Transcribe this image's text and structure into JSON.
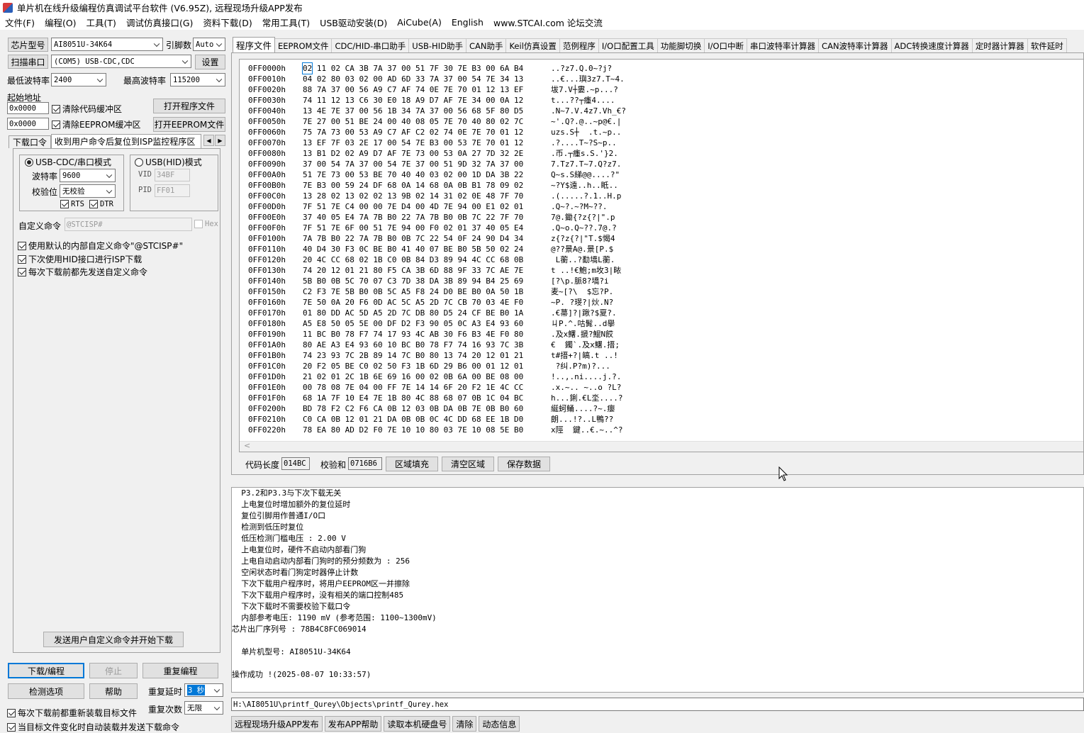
{
  "window": {
    "title": "单片机在线升级编程仿真调试平台软件 (V6.95Z), 远程现场升级APP发布"
  },
  "menu": [
    "文件(F)",
    "编程(O)",
    "工具(T)",
    "调试仿真接口(G)",
    "资料下载(D)",
    "常用工具(T)",
    "USB驱动安装(D)",
    "AiCube(A)",
    "English",
    "www.STCAI.com 论坛交流"
  ],
  "left": {
    "chip_btn": "芯片型号",
    "chip_value": "AI8051U-34K64",
    "pin_label": "引脚数",
    "pin_value": "Auto",
    "scan_btn": "扫描串口",
    "port_value": "(COM5) USB-CDC,CDC",
    "settings_btn": "设置",
    "min_baud_label": "最低波特率",
    "min_baud_value": "2400",
    "max_baud_label": "最高波特率",
    "max_baud_value": "115200",
    "start_addr_label": "起始地址",
    "addr1": "0x0000",
    "clear_code_label": "清除代码缓冲区",
    "open_prog_btn": "打开程序文件",
    "addr2": "0x0000",
    "clear_eeprom_label": "清除EEPROM缓冲区",
    "open_eeprom_btn": "打开EEPROM文件",
    "subtab1": "下载口令",
    "subtab2": "收到用户命令后复位到ISP监控程序区",
    "usb_cdc_mode": "USB-CDC/串口模式",
    "usb_hid_mode": "USB(HID)模式",
    "baud_label": "波特率",
    "baud_value": "9600",
    "parity_label": "校验位",
    "parity_value": "无校验",
    "rts_label": "RTS",
    "dtr_label": "DTR",
    "vid_label": "VID",
    "vid_value": "34BF",
    "pid_label": "PID",
    "pid_value": "FF01",
    "custom_cmd_label": "自定义命令",
    "custom_cmd_value": "@STCISP#",
    "hex_label": "Hex",
    "opt1": "使用默认的内部自定义命令\"@STCISP#\"",
    "opt2": "下次使用HID接口进行ISP下载",
    "opt3": "每次下载前都先发送自定义命令",
    "send_btn": "发送用户自定义命令并开始下载",
    "download_btn": "下载/编程",
    "stop_btn": "停止",
    "reprogram_btn": "重复编程",
    "check_btn": "检测选项",
    "help_btn": "帮助",
    "repeat_delay_label": "重复延时",
    "repeat_delay_value": "3 秒",
    "reload_label": "每次下载前都重新装载目标文件",
    "repeat_count_label": "重复次数",
    "repeat_count_value": "无限",
    "auto_label": "当目标文件变化时自动装载并发送下载命令"
  },
  "tabs": [
    "程序文件",
    "EEPROM文件",
    "CDC/HID-串口助手",
    "USB-HID助手",
    "CAN助手",
    "Keil仿真设置",
    "范例程序",
    "I/O口配置工具",
    "功能脚切换",
    "I/O口中断",
    "串口波特率计算器",
    "CAN波特率计算器",
    "ADC转换速度计算器",
    "定时器计算器",
    "软件延时"
  ],
  "hex": [
    {
      "a": "0FF0000h",
      "h": "02 11 02 CA 3B 7A 37 00 51 7F 30 7E B3 00 6A B4",
      "t": "..?z7.Q.0~?j?"
    },
    {
      "a": "0FF0010h",
      "h": "04 02 80 03 02 00 AD 6D 33 7A 37 00 54 7E 34 13",
      "t": "..€...璵3z7.T~4."
    },
    {
      "a": "0FF0020h",
      "h": "88 7A 37 00 56 A9 C7 AF 74 0E 7E 70 01 12 13 EF",
      "t": "坺7.V┼婁.~p...?"
    },
    {
      "a": "0FF0030h",
      "h": "74 11 12 13 C6 30 E0 18 A9 D7 AF 7E 34 00 0A 12",
      "t": "t...??┬瘇4...."
    },
    {
      "a": "0FF0040h",
      "h": "13 4E 7E 37 00 56 1B 34 7A 37 00 56 68 5F 80 D5",
      "t": ".N~7.V.4z7.Vh_€?"
    },
    {
      "a": "0FF0050h",
      "h": "7E 27 00 51 BE 24 00 40 08 05 7E 70 40 80 02 7C",
      "t": "~'.Q?.@..~p@€.|"
    },
    {
      "a": "0FF0060h",
      "h": "75 7A 73 00 53 A9 C7 AF C2 02 74 0E 7E 70 01 12",
      "t": "uzs.S┼  .t.~p.."
    },
    {
      "a": "0FF0070h",
      "h": "13 EF 7F 03 2E 17 00 54 7E B3 00 53 7E 70 01 12",
      "t": ".?....T~?S~p.."
    },
    {
      "a": "0FF0080h",
      "h": "13 B1 D2 02 A9 D7 AF 7E 73 00 53 0A 27 7D 32 2E",
      "t": ".币.┬瘇s.S.'}2."
    },
    {
      "a": "0FF0090h",
      "h": "37 00 54 7A 37 00 54 7E 37 00 51 9D 32 7A 37 00",
      "t": "7.Tz7.T~7.Q?z7."
    },
    {
      "a": "0FF00A0h",
      "h": "51 7E 73 00 53 BE 70 40 40 03 02 00 1D DA 3B 22",
      "t": "Q~s.S綈@@....?\""
    },
    {
      "a": "0FF00B0h",
      "h": "7E B3 00 59 24 DF 68 0A 14 68 0A 0B B1 78 09 02",
      "t": "~?Y$遠..h..眡.."
    },
    {
      "a": "0FF00C0h",
      "h": "13 28 02 13 02 02 13 9B 02 14 31 02 0E 48 7F 70",
      "t": ".(.....?.1..H.p"
    },
    {
      "a": "0FF00D0h",
      "h": "7F 51 7E C4 00 00 7E D4 00 4D 7E 94 00 E1 02 01",
      "t": ".Q~?.~?M~??."
    },
    {
      "a": "0FF00E0h",
      "h": "37 40 05 E4 7A 7B B0 22 7A 7B B0 0B 7C 22 7F 70",
      "t": "7@.鋤{?z{?|\".p"
    },
    {
      "a": "0FF00F0h",
      "h": "7F 51 7E 6F 00 51 7E 94 00 F0 02 01 37 40 05 E4",
      "t": ".Q~o.Q~??.7@.?"
    },
    {
      "a": "0FF0100h",
      "h": "7A 7B B0 22 7A 7B B0 0B 7C 22 54 0F 24 90 D4 34",
      "t": "z{?z{?|\"T.$愒4"
    },
    {
      "a": "0FF0110h",
      "h": "40 D4 30 F3 0C BE B0 41 40 07 BE B0 5B 50 02 24",
      "t": "@??景A@.景[P.$"
    },
    {
      "a": "0FF0120h",
      "h": "20 4C CC 68 02 1B C0 0B 84 D3 89 94 4C CC 68 0B",
      "t": " L蘅..?勫墧L蘅."
    },
    {
      "a": "0FF0130h",
      "h": "74 20 12 01 21 80 F5 CA 3B 6D 88 9F 33 7C AE 7E",
      "t": "t ..!€鮑;m坆3|畩"
    },
    {
      "a": "0FF0140h",
      "h": "5B B0 0B 5C 70 07 C3 7D 38 DA 3B 89 94 B4 25 69",
      "t": "[?\\p.脈8?墧?i"
    },
    {
      "a": "0FF0150h",
      "h": "C2 F3 7E 5B B0 0B 5C A5 F8 24 D0 BE B0 0A 50 1B",
      "t": "麦~[?\\  $忘?P."
    },
    {
      "a": "0FF0160h",
      "h": "7E 50 0A 20 F6 0D AC 5C A5 2D 7C CB 70 03 4E F0",
      "t": "~P. ?琝?|炏.N?"
    },
    {
      "a": "0FF0170h",
      "h": "01 80 DD AC 5D A5 2D 7C DB 80 D5 24 CF BE B0 1A",
      "t": ".€菷]?|踿?$夏?."
    },
    {
      "a": "0FF0180h",
      "h": "A5 E8 50 05 5E 00 DF D2 F3 90 05 0C A3 E4 93 60",
      "t": "ㄐP.^.咕髴..d擧"
    },
    {
      "a": "0FF0190h",
      "h": "11 BC B0 78 F7 74 17 93 4C AB 30 F6 B3 4E F0 80",
      "t": ".及x鱰.搋?鯤N餀"
    },
    {
      "a": "0FF01A0h",
      "h": "80 AE A3 E4 93 60 10 BC B0 78 F7 74 16 93 7C 3B",
      "t": "€  鐲`.及x鱰.搢;"
    },
    {
      "a": "0FF01B0h",
      "h": "74 23 93 7C 2B 89 14 7C B0 80 13 74 20 12 01 21",
      "t": "t#搢+?|皜.t ..!"
    },
    {
      "a": "0FF01C0h",
      "h": "20 F2 05 BE C0 02 50 F3 1B 6D 29 B6 00 01 12 01",
      "t": " ?纠.P?m)?..."
    },
    {
      "a": "0FF01D0h",
      "h": "21 02 01 2C 1B 6E 69 16 00 02 0B 6A 00 BE 08 00",
      "t": "!..,.ni....j.?."
    },
    {
      "a": "0FF01E0h",
      "h": "00 78 08 7E 04 00 FF 7E 14 14 6F 20 F2 1E 4C CC",
      "t": ".x.~.. ~..o ?L?"
    },
    {
      "a": "0FF01F0h",
      "h": "68 1A 7F 10 E4 7E 1B 80 4C 88 68 07 0B 1C 04 BC",
      "t": "h...鋓.€L坔....?"
    },
    {
      "a": "0FF0200h",
      "h": "BD 78 F2 C2 F6 CA 0B 12 03 0B DA 0B 7E 0B B0 60",
      "t": "綖蚵鲬....?~.癭"
    },
    {
      "a": "0FF0210h",
      "h": "C0 CA 0B 12 01 21 DA 0B 0B 0C 4C DD 68 EE 1B D0",
      "t": "朗...!?..L鴨??"
    },
    {
      "a": "0FF0220h",
      "h": "78 EA 80 AD D2 F0 7E 10 10 80 03 7E 10 08 5E B0",
      "t": "x陘  鍵..€.~..^?"
    }
  ],
  "hexbar": {
    "code_len_label": "代码长度",
    "code_len_value": "014BC",
    "checksum_label": "校验和",
    "checksum_value": "0716B6",
    "fill_btn": "区域填充",
    "clear_btn": "清空区域",
    "save_btn": "保存数据"
  },
  "log": [
    "  P3.2和P3.3与下次下载无关",
    "  上电复位时增加额外的复位延时",
    "  复位引脚用作普通I/O口",
    "  检测到低压时复位",
    "  低压检测门槛电压 : 2.00 V",
    "  上电复位时，硬件不启动内部看门狗",
    "  上电自动启动内部看门狗时的预分频数为 : 256",
    "  空闲状态时看门狗定时器停止计数",
    "  下次下载用户程序时，将用户EEPROM区一并擦除",
    "  下次下载用户程序时，没有相关的端口控制485",
    "  下次下载时不需要校验下载口令",
    "  内部参考电压: 1190 mV (参考范围: 1100~1300mV)",
    "芯片出厂序列号 : 78B4C8FC069014",
    "",
    "  单片机型号: AI8051U-34K64",
    "",
    "操作成功 !(2025-08-07 10:33:57)"
  ],
  "path": "H:\\AI8051U\\printf_Qurey\\Objects\\printf_Qurey.hex",
  "bottom_buttons": [
    "远程现场升级APP发布",
    "发布APP帮助",
    "读取本机硬盘号",
    "清除",
    "动态信息"
  ]
}
